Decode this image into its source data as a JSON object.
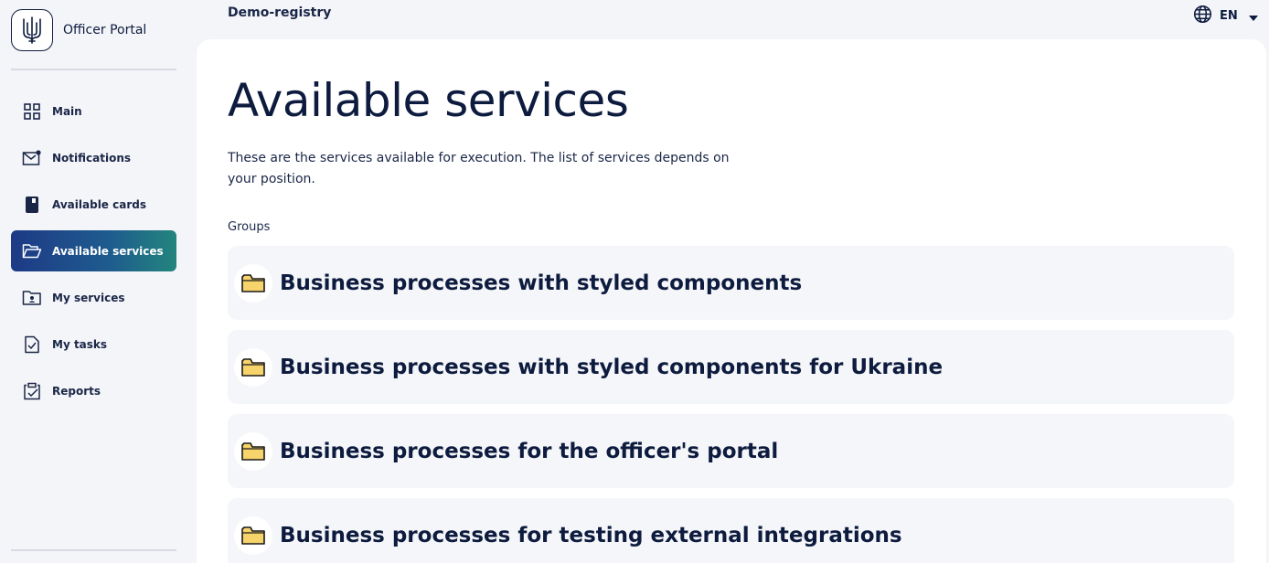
{
  "app": {
    "name": "Officer Portal",
    "registry": "Demo-registry"
  },
  "language": {
    "code": "EN",
    "icon": "globe-icon"
  },
  "sidebar": {
    "items": [
      {
        "label": "Main",
        "icon": "grid-icon",
        "active": false
      },
      {
        "label": "Notifications",
        "icon": "mail-icon",
        "active": false
      },
      {
        "label": "Available cards",
        "icon": "card-icon",
        "active": false
      },
      {
        "label": "Available services",
        "icon": "folder-open-icon",
        "active": true
      },
      {
        "label": "My services",
        "icon": "folder-user-icon",
        "active": false
      },
      {
        "label": "My tasks",
        "icon": "task-icon",
        "active": false
      },
      {
        "label": "Reports",
        "icon": "clipboard-icon",
        "active": false
      }
    ]
  },
  "main": {
    "title": "Available services",
    "description": "These are the services available for execution. The list of services depends on your position.",
    "groups_label": "Groups",
    "groups": [
      {
        "title": "Business processes with styled components",
        "icon": "folder-icon"
      },
      {
        "title": "Business processes with styled components for Ukraine",
        "icon": "folder-icon"
      },
      {
        "title": "Business processes for the officer's portal",
        "icon": "folder-icon"
      },
      {
        "title": "Business processes for testing external integrations",
        "icon": "folder-icon"
      }
    ]
  },
  "colors": {
    "primary": "#0d1b3e",
    "active_gradient_start": "#1d3a86",
    "active_gradient_end": "#23857d",
    "folder": "#f7d36b"
  }
}
